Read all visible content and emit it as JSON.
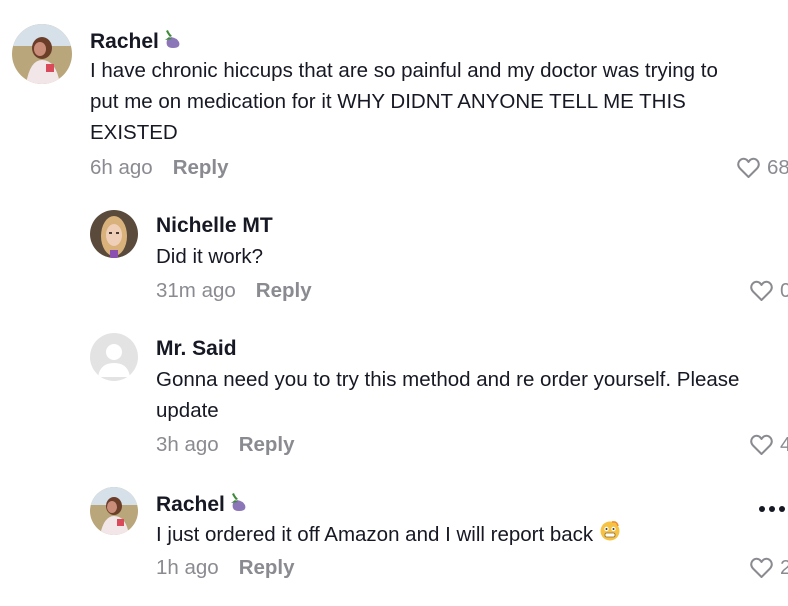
{
  "comments": [
    {
      "username": "Rachel",
      "username_emoji": "eggplant-emoji",
      "text": "I have chronic hiccups that are so painful and my doctor was trying to\nput me on medication for it WHY DIDNT ANYONE TELL ME THIS\nEXISTED",
      "time": "6h ago",
      "reply_label": "Reply",
      "likes": "68",
      "avatar": "rachel-avatar"
    },
    {
      "username": "Nichelle MT",
      "text": "Did it work?",
      "time": "31m ago",
      "reply_label": "Reply",
      "likes": "0",
      "avatar": "nichelle-avatar"
    },
    {
      "username": "Mr. Said",
      "text": "Gonna need you to try this method and re order yourself. Please\nupdate",
      "time": "3h ago",
      "reply_label": "Reply",
      "likes": "4",
      "avatar": "default-user-avatar"
    },
    {
      "username": "Rachel",
      "username_emoji": "eggplant-emoji",
      "text": "I just ordered it off Amazon and I will report back",
      "text_emoji": "grimace-face-emoji",
      "time": "1h ago",
      "reply_label": "Reply",
      "likes": "2",
      "avatar": "rachel-avatar"
    }
  ],
  "icons": {
    "like": "heart-outline-icon",
    "more": "more-options-icon"
  },
  "colors": {
    "text": "#161823",
    "meta": "#8a8b91",
    "background": "#ffffff"
  }
}
